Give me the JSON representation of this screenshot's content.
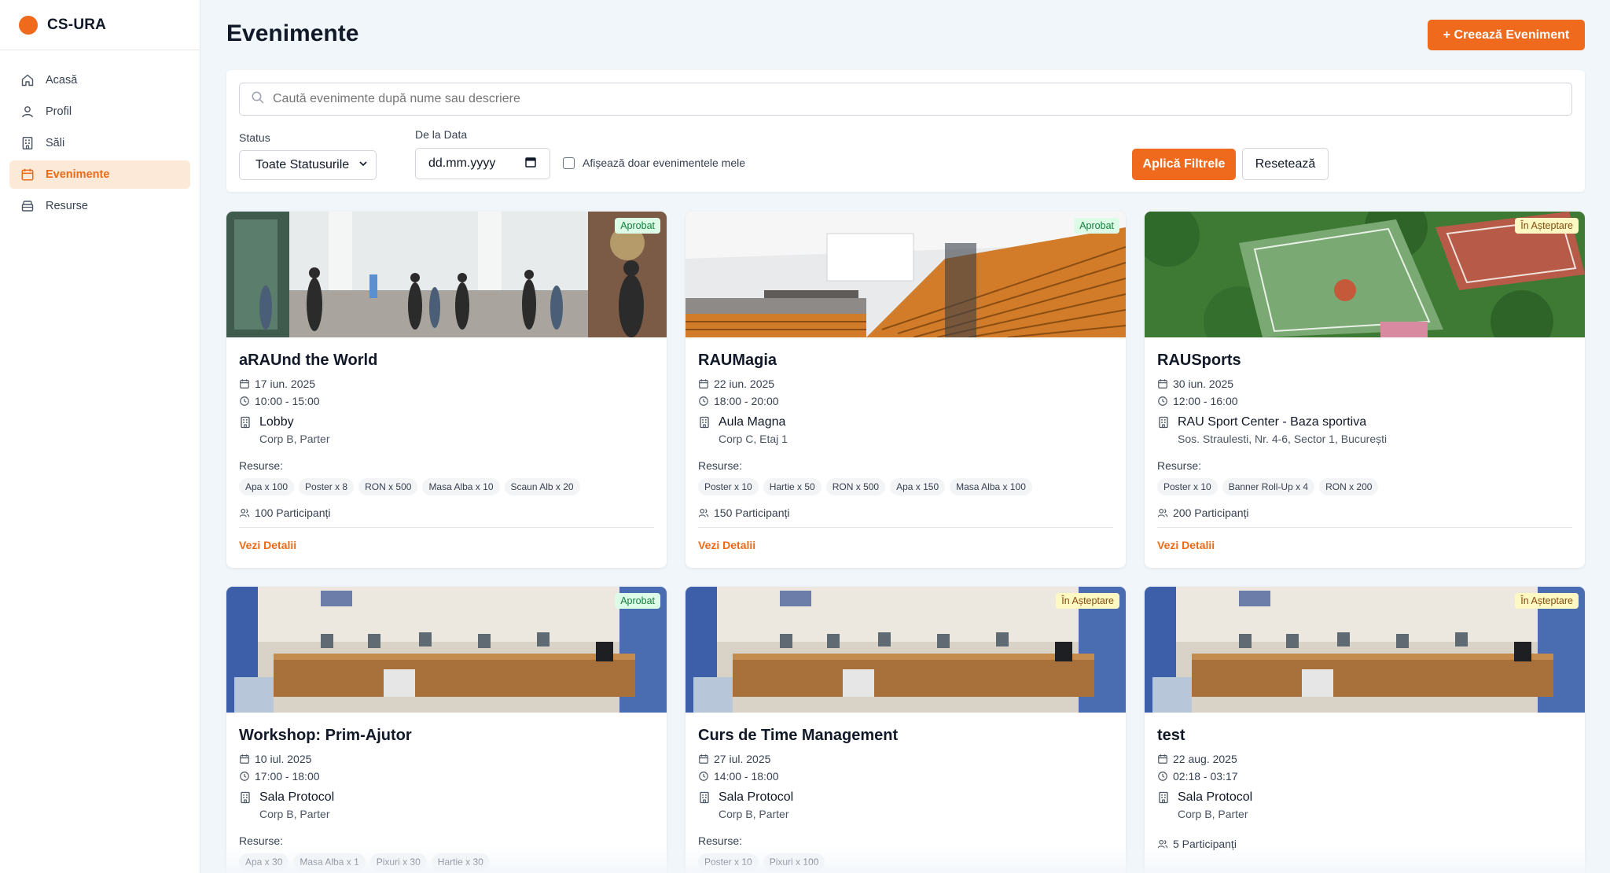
{
  "app": {
    "name": "CS-URA",
    "accent": "#f06a1d"
  },
  "sidebar": {
    "items": [
      {
        "label": "Acasă",
        "icon": "home-icon"
      },
      {
        "label": "Profil",
        "icon": "user-icon"
      },
      {
        "label": "Săli",
        "icon": "building-icon"
      },
      {
        "label": "Evenimente",
        "icon": "calendar-icon",
        "active": true
      },
      {
        "label": "Resurse",
        "icon": "box-icon"
      }
    ]
  },
  "header": {
    "title": "Evenimente",
    "create_label": "+  Creează Eveniment"
  },
  "filters": {
    "search_placeholder": "Caută evenimente după nume sau descriere",
    "status_label": "Status",
    "status_value": "Toate Statusurile",
    "date_label": "De la Data",
    "date_value": "dd.mm.yyyy",
    "only_mine_label": "Afișează doar evenimentele mele",
    "apply_label": "Aplică Filtrele",
    "reset_label": "Resetează"
  },
  "labels": {
    "resources": "Resurse:",
    "details": "Vezi Detalii"
  },
  "events": [
    {
      "title": "aRAUnd the World",
      "status": "Aprobat",
      "status_type": "approved",
      "date": "17 iun. 2025",
      "time": "10:00 - 15:00",
      "location": "Lobby",
      "location_sub": "Corp B, Parter",
      "resources": [
        "Apa x 100",
        "Poster x 8",
        "RON x 500",
        "Masa Alba x 10",
        "Scaun Alb x 20"
      ],
      "participants": "100 Participanți",
      "image": "lobby"
    },
    {
      "title": "RAUMagia",
      "status": "Aprobat",
      "status_type": "approved",
      "date": "22 iun. 2025",
      "time": "18:00 - 20:00",
      "location": "Aula Magna",
      "location_sub": "Corp C, Etaj 1",
      "resources": [
        "Poster x 10",
        "Hartie x 50",
        "RON x 500",
        "Apa x 150",
        "Masa Alba x 100"
      ],
      "participants": "150 Participanți",
      "image": "auditorium"
    },
    {
      "title": "RAUSports",
      "status": "În Așteptare",
      "status_type": "pending",
      "date": "30 iun. 2025",
      "time": "12:00 - 16:00",
      "location": "RAU Sport Center - Baza sportiva",
      "location_sub": "Sos. Straulesti, Nr. 4-6, Sector 1, București",
      "resources": [
        "Poster x 10",
        "Banner Roll-Up x 4",
        "RON x 200"
      ],
      "participants": "200 Participanți",
      "image": "sports"
    },
    {
      "title": "Workshop: Prim-Ajutor",
      "status": "Aprobat",
      "status_type": "approved",
      "date": "10 iul. 2025",
      "time": "17:00 - 18:00",
      "location": "Sala Protocol",
      "location_sub": "Corp B, Parter",
      "resources": [
        "Apa x 30",
        "Masa Alba x 1",
        "Pixuri x 30",
        "Hartie x 30"
      ],
      "participants": "",
      "image": "classroom"
    },
    {
      "title": "Curs de Time Management",
      "status": "În Așteptare",
      "status_type": "pending",
      "date": "27 iul. 2025",
      "time": "14:00 - 18:00",
      "location": "Sala Protocol",
      "location_sub": "Corp B, Parter",
      "resources": [
        "Poster x 10",
        "Pixuri x 100"
      ],
      "participants": "",
      "image": "classroom"
    },
    {
      "title": "test",
      "status": "În Așteptare",
      "status_type": "pending",
      "date": "22 aug. 2025",
      "time": "02:18 - 03:17",
      "location": "Sala Protocol",
      "location_sub": "Corp B, Parter",
      "resources": [],
      "participants": "5 Participanți",
      "image": "classroom"
    }
  ]
}
